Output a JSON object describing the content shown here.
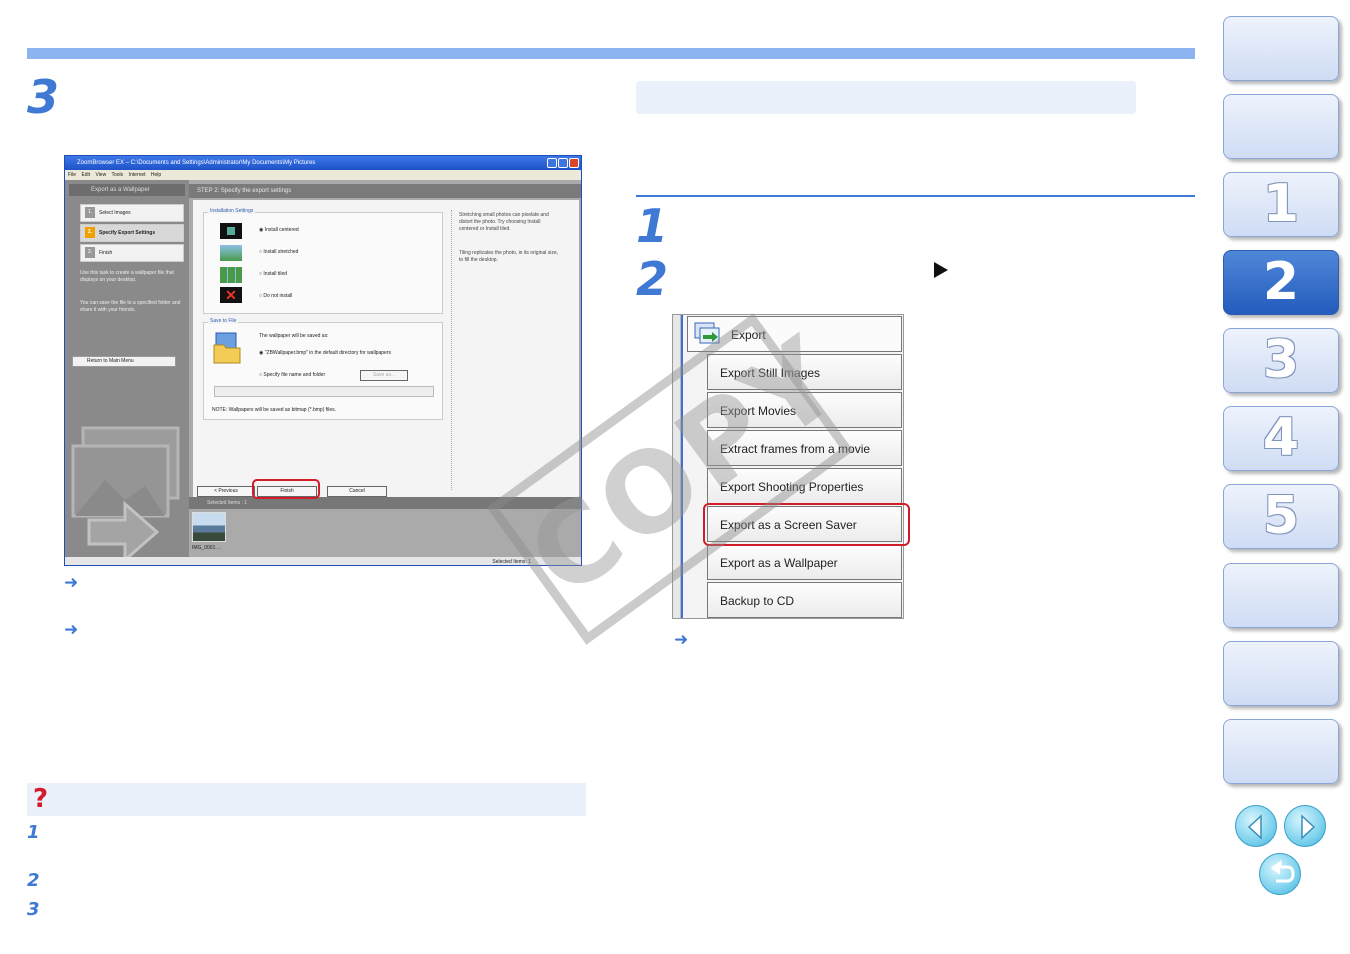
{
  "step_numbers": {
    "main": "3",
    "right_1": "1",
    "right_2": "2"
  },
  "faq_steps": [
    "1",
    "2",
    "3"
  ],
  "screenshot": {
    "title": "ZoomBrowser EX  –  C:\\Documents and Settings\\Administrator\\My Documents\\My Pictures",
    "menu": "File Edit View Tools Internet Help",
    "task_title": "Export as a Wallpaper",
    "step_header": "STEP 2: Specify the export settings",
    "steps": [
      {
        "num": "1.",
        "label": "Select Images"
      },
      {
        "num": "2.",
        "label": "Specify Export Settings"
      },
      {
        "num": "3.",
        "label": "Finish"
      }
    ],
    "desc_1": "Use this task to create a wallpaper file that displays on your desktop.",
    "desc_2": "You can save the file to a specified folder and share it with your friends.",
    "return_btn": "Return to Main Menu",
    "install_group": "Installation Settings",
    "install_options": [
      "Install centered",
      "Install stretched",
      "Install tiled",
      "Do not install"
    ],
    "note_1": "Stretching small photos can pixelate and distort the photo. Try choosing Install centered or Install tiled.",
    "note_2": "Tiling replicates the photo, in its original size, to fill the desktop.",
    "save_group": "Save to File",
    "save_caption": "The wallpaper will be saved as:",
    "save_option_1": "\"ZBWallpaper.bmp\" in the default directory for wallpapers",
    "save_option_2": "Specify file name and folder",
    "save_as_btn": "Save as...",
    "bmp_note": "NOTE: Wallpapers will be saved as bitmap (*.bmp) files.",
    "prev_btn": "< Previous",
    "finish_btn": "Finish",
    "cancel_btn": "Cancel",
    "selected_header": "Selected Items : 1",
    "thumb_caption": "IMG_0001 ...",
    "status": "Selected Items: 1"
  },
  "export_menu": {
    "header": "Export",
    "items": [
      "Export Still Images",
      "Export Movies",
      "Extract frames from a movie",
      "Export Shooting Properties",
      "Export as a Screen Saver",
      "Export as a Wallpaper",
      "Backup to CD"
    ]
  },
  "watermark": "COPY",
  "faq_icon": "?",
  "sidebar": {
    "tabs": [
      "",
      "",
      "1",
      "2",
      "3",
      "4",
      "5",
      "",
      "",
      ""
    ],
    "active": "2"
  },
  "icons": {
    "arrow": "➜",
    "prev": "prev-page-icon",
    "next": "next-page-icon",
    "back": "back-icon"
  },
  "colors": {
    "accent": "#3f79d4",
    "highlight": "#d21c2a",
    "active_tab": "#245cbe",
    "bar": "#8cb4f0"
  }
}
